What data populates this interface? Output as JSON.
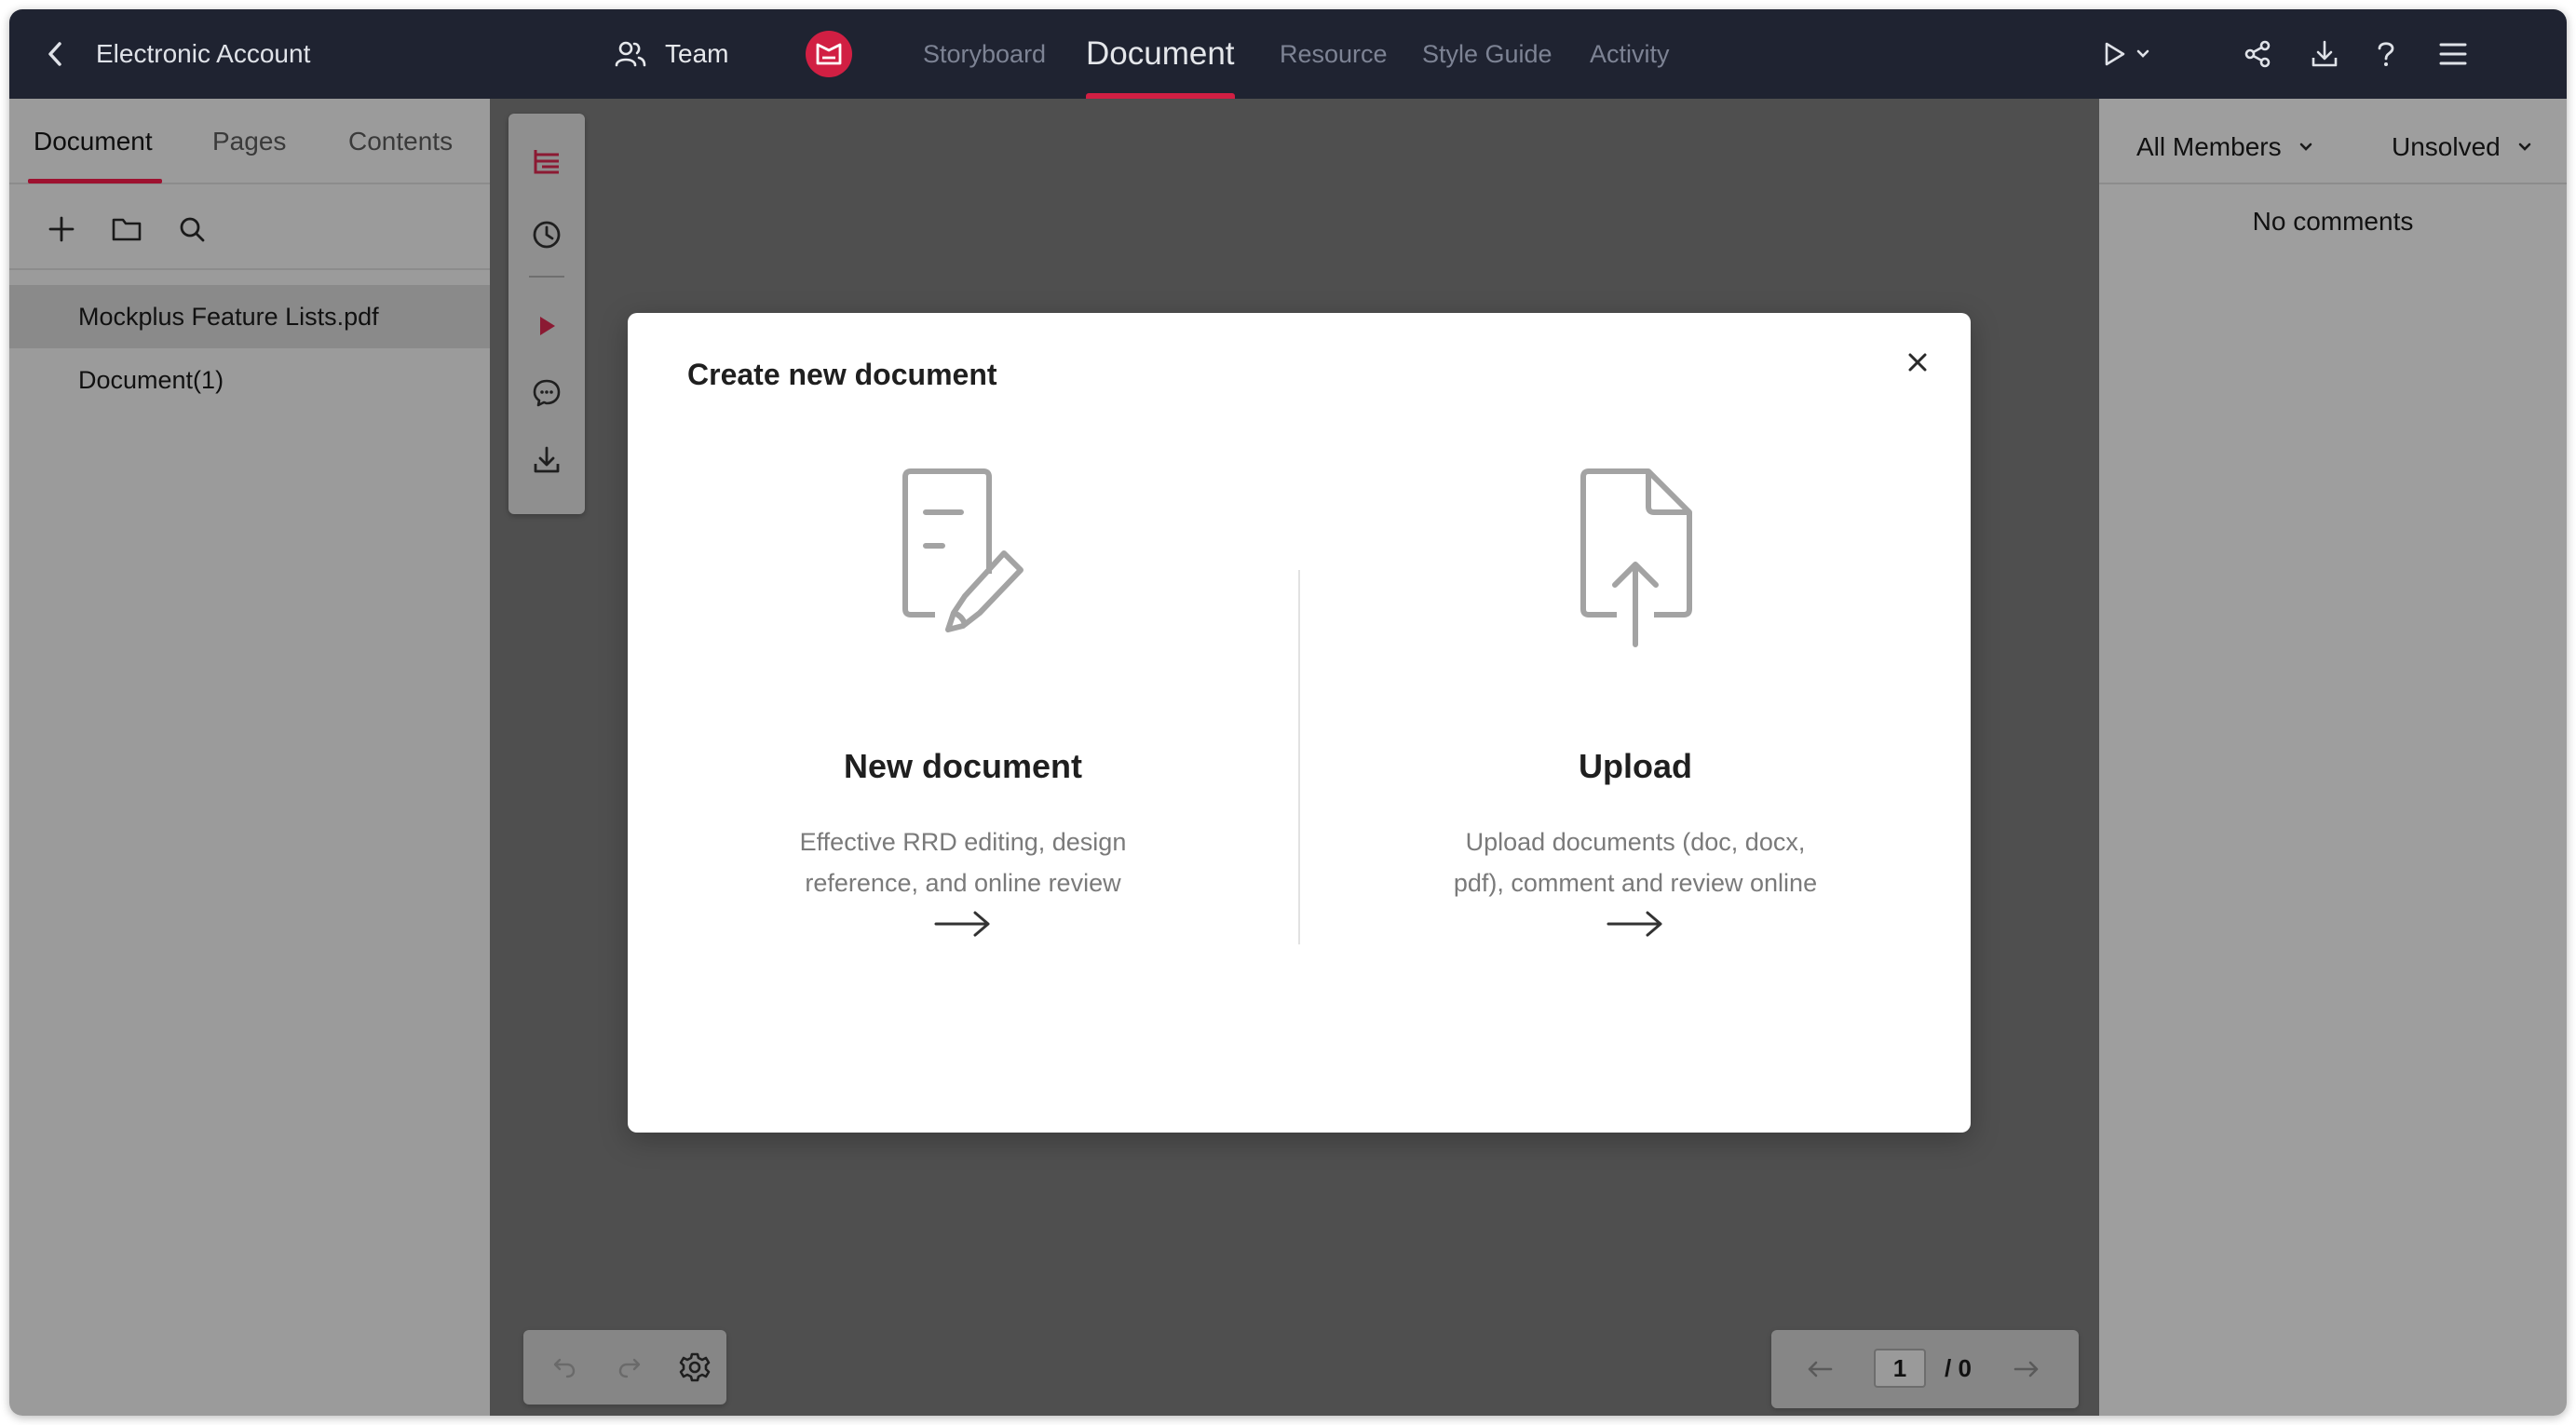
{
  "topbar": {
    "back_icon": "chevron-left-icon",
    "project_title": "Electronic Account",
    "team_label": "Team",
    "team_icon": "users-icon",
    "logo_icon": "mockplus-logo-icon",
    "nav_tabs": [
      "Storyboard",
      "Document",
      "Resource",
      "Style Guide",
      "Activity"
    ],
    "active_tab": "Document",
    "right_icons": [
      "play-icon",
      "chevron-down-icon",
      "share-icon",
      "download-icon",
      "help-icon",
      "menu-icon"
    ],
    "accent_color": "#d11f43",
    "background_color": "#1f2331"
  },
  "left_panel": {
    "tabs": [
      "Document",
      "Pages",
      "Contents"
    ],
    "active_tab": "Document",
    "tools": [
      "plus-icon",
      "folder-icon",
      "search-icon"
    ],
    "files": [
      {
        "name": "Mockplus Feature Lists.pdf",
        "selected": true
      },
      {
        "name": "Document(1)",
        "selected": false
      }
    ]
  },
  "canvas": {
    "vertical_toolbar": [
      "outline-icon",
      "history-icon",
      "pointer-icon",
      "comment-icon",
      "download-icon"
    ],
    "bottom_toolbar": [
      "undo-icon",
      "redo-icon",
      "settings-icon"
    ],
    "pager": {
      "current_page": "1",
      "total": "/ 0"
    }
  },
  "right_panel": {
    "filter_members": "All Members",
    "filter_status": "Unsolved",
    "empty_text": "No comments"
  },
  "modal": {
    "title": "Create new document",
    "close_icon": "close-icon",
    "options": [
      {
        "icon": "document-edit-icon",
        "title": "New document",
        "description": "Effective RRD editing, design reference, and online review",
        "arrow": "arrow-right-icon"
      },
      {
        "icon": "file-upload-icon",
        "title": "Upload",
        "description": "Upload documents (doc, docx, pdf), comment and review online",
        "arrow": "arrow-right-icon"
      }
    ]
  }
}
